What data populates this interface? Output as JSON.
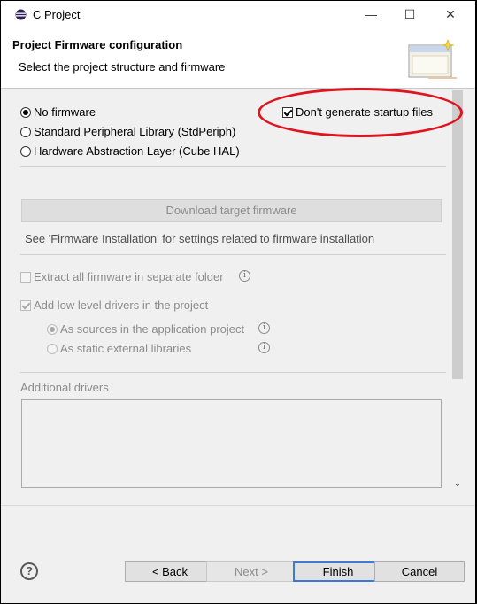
{
  "window": {
    "title": "C Project",
    "minimize_glyph": "—",
    "maximize_glyph": "☐",
    "close_glyph": "✕"
  },
  "header": {
    "title": "Project Firmware configuration",
    "subtitle": "Select the project structure and firmware",
    "banner_icon": "wizard-banner-icon"
  },
  "firmware": {
    "options": [
      {
        "label": "No firmware",
        "selected": true
      },
      {
        "label": "Standard Peripheral Library (StdPeriph)",
        "selected": false
      },
      {
        "label": "Hardware Abstraction Layer (Cube HAL)",
        "selected": false
      }
    ],
    "no_startup_files": {
      "label": "Don't generate startup files",
      "checked": true
    }
  },
  "download": {
    "button_label": "Download target firmware",
    "see_prefix": "See ",
    "see_link": "'Firmware Installation'",
    "see_suffix": " for settings related to firmware installation"
  },
  "options": {
    "extract": {
      "label": "Extract all firmware in separate folder",
      "checked": false
    },
    "add_ll": {
      "label": "Add low level drivers in the project",
      "checked": true
    },
    "as_sources": {
      "label": "As sources in the application project",
      "selected": true
    },
    "as_static": {
      "label": "As static external libraries",
      "selected": false
    }
  },
  "additional_drivers": {
    "label": "Additional drivers"
  },
  "footer": {
    "help_glyph": "?",
    "back_label": "< Back",
    "next_label": "Next >",
    "finish_label": "Finish",
    "cancel_label": "Cancel"
  },
  "annotation_color": "#e0141e"
}
